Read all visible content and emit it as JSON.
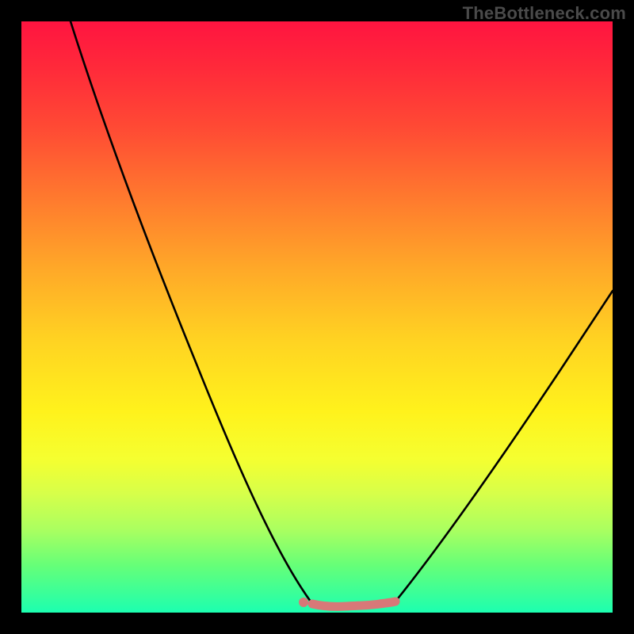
{
  "watermark": {
    "text": "TheBottleneck.com"
  },
  "colors": {
    "background": "#000000",
    "curve": "#000000",
    "flat_marker": "#d97a7a",
    "flat_dot": "#d97a7a"
  },
  "chart_data": {
    "type": "line",
    "title": "",
    "xlabel": "",
    "ylabel": "",
    "xlim": [
      0,
      100
    ],
    "ylim": [
      0,
      100
    ],
    "grid": false,
    "legend": false,
    "series": [
      {
        "name": "left-branch",
        "x": [
          8.5,
          12,
          16,
          20,
          25,
          30,
          35,
          40,
          44,
          47,
          50
        ],
        "values": [
          100,
          89,
          78,
          67,
          55,
          43,
          32,
          20,
          10,
          4,
          0.5
        ]
      },
      {
        "name": "right-branch",
        "x": [
          63,
          67,
          72,
          78,
          84,
          90,
          95,
          100
        ],
        "values": [
          0.5,
          6,
          13,
          22,
          31,
          40,
          47,
          55
        ]
      },
      {
        "name": "flat-bottom",
        "x": [
          50,
          52,
          55,
          58,
          61,
          63
        ],
        "values": [
          0.5,
          0.4,
          0.4,
          0.5,
          0.6,
          0.5
        ]
      }
    ],
    "annotations": []
  }
}
